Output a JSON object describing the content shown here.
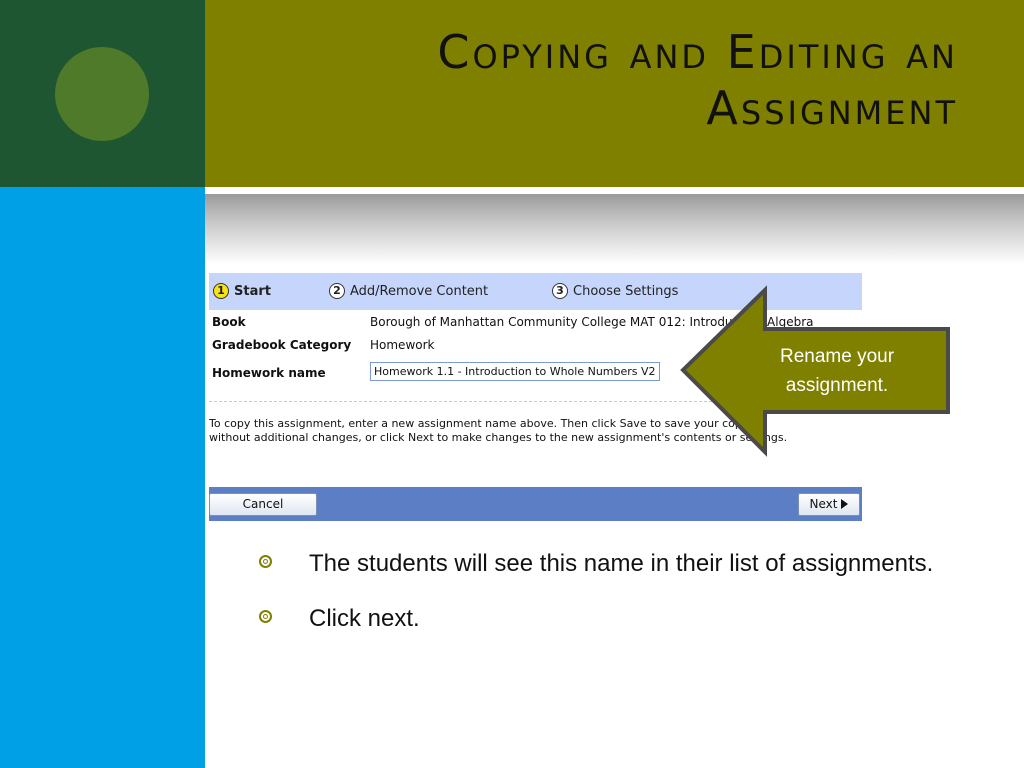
{
  "slide": {
    "title_line1": "Copying and Editing an",
    "title_line2": "Assignment"
  },
  "wizard": {
    "steps": [
      {
        "num": "1",
        "label": "Start"
      },
      {
        "num": "2",
        "label": "Add/Remove Content"
      },
      {
        "num": "3",
        "label": "Choose Settings"
      }
    ],
    "book_label": "Book",
    "book_value": "Borough of Manhattan Community College MAT 012: Introductory Algebra",
    "category_label": "Gradebook Category",
    "category_value": "Homework",
    "hw_name_label": "Homework name",
    "hw_name_value": "Homework 1.1 - Introduction to Whole Numbers V2",
    "instructions_line1": "To copy this assignment, enter a new assignment name above. Then click Save to save your copy",
    "instructions_line2": "without additional changes, or click Next to make changes to the new assignment's contents or settings.",
    "cancel_label": "Cancel",
    "next_label": "Next"
  },
  "callout": {
    "line1": "Rename your",
    "line2": "assignment."
  },
  "bullets": [
    "The students will see this name in their list of assignments.",
    "Click next."
  ],
  "colors": {
    "header": "#7f7f00",
    "left_top": "#1e5631",
    "left_bottom": "#00a0e6",
    "circle": "#4e7a2a",
    "wizard_header": "#c5d5fb",
    "wizard_footer": "#5b7ec5",
    "callout_fill": "#7f7f00",
    "callout_border": "#4a4a4a"
  },
  "icons": {
    "bullet": "target-bullet-icon",
    "next_arrow": "triangle-right-icon"
  }
}
